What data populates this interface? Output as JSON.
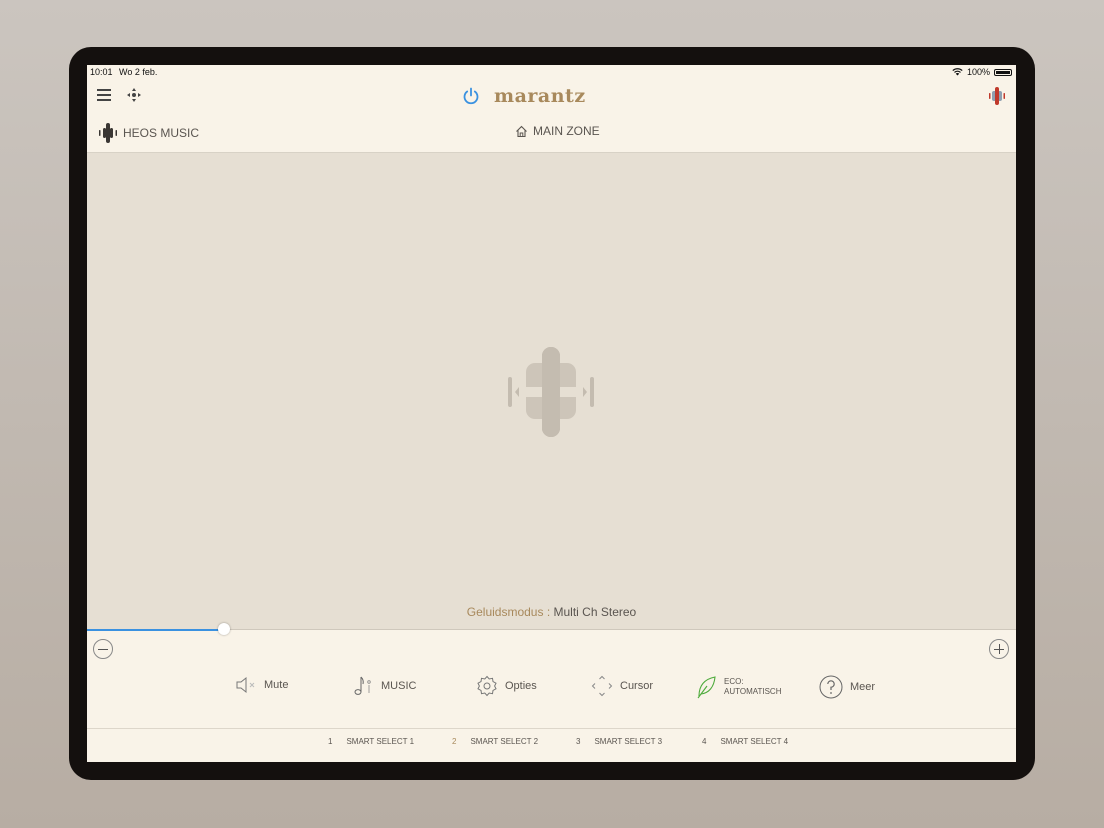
{
  "status_bar": {
    "time": "10:01",
    "date": "Wo 2 feb.",
    "battery": "100%"
  },
  "header": {
    "brand": "marantz"
  },
  "source": {
    "label": "HEOS MUSIC"
  },
  "zone": {
    "label": "MAIN ZONE"
  },
  "sound_mode": {
    "label": "Geluidsmodus",
    "separator": ":",
    "value": "Multi Ch Stereo"
  },
  "volume": {
    "level_fraction": 0.148
  },
  "controls": {
    "mute": "Mute",
    "input": "MUSIC",
    "options": "Opties",
    "cursor": "Cursor",
    "eco_line1": "ECO:",
    "eco_line2": "AUTOMATISCH",
    "more": "Meer"
  },
  "smart_select": [
    {
      "num": "1",
      "label": "SMART SELECT 1"
    },
    {
      "num": "2",
      "label": "SMART SELECT 2"
    },
    {
      "num": "3",
      "label": "SMART SELECT 3"
    },
    {
      "num": "4",
      "label": "SMART SELECT 4"
    }
  ],
  "colors": {
    "accent_gold": "#a8895c",
    "accent_blue": "#3a91e0",
    "eco_green": "#4caa3a"
  }
}
